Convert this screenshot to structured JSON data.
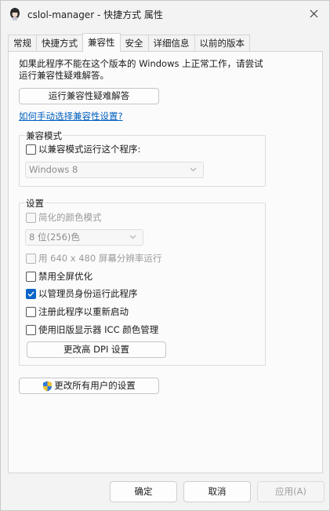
{
  "window": {
    "title": "cslol-manager - 快捷方式 属性",
    "close_glyph": "✕"
  },
  "tabs": [
    {
      "label": "常规",
      "active": false
    },
    {
      "label": "快捷方式",
      "active": false
    },
    {
      "label": "兼容性",
      "active": true
    },
    {
      "label": "安全",
      "active": false
    },
    {
      "label": "详细信息",
      "active": false
    },
    {
      "label": "以前的版本",
      "active": false
    }
  ],
  "intro": {
    "line1": "如果此程序不能在这个版本的 Windows 上正常工作，请尝试",
    "line2": "运行兼容性疑难解答。"
  },
  "troubleshoot_button": "运行兼容性疑难解答",
  "manual_link": "如何手动选择兼容性设置?",
  "compat_mode": {
    "title": "兼容模式",
    "checkbox_label": "以兼容模式运行这个程序:",
    "select_value": "Windows 8"
  },
  "settings": {
    "title": "设置",
    "reduced_color": "简化的颜色模式",
    "color_select_value": "8 位(256)色",
    "run_640": "用 640 x 480 屏幕分辨率运行",
    "disable_fullscreen": "禁用全屏优化",
    "run_as_admin": "以管理员身份运行此程序",
    "register_restart": "注册此程序以重新启动",
    "legacy_icc": "使用旧版显示器 ICC 颜色管理",
    "dpi_button": "更改高 DPI 设置",
    "run_as_admin_checked": true
  },
  "all_users_button": "更改所有用户的设置",
  "footer": {
    "ok": "确定",
    "cancel": "取消",
    "apply": "应用(A)"
  },
  "colors": {
    "accent": "#0a64c8",
    "link": "#0060c0"
  }
}
